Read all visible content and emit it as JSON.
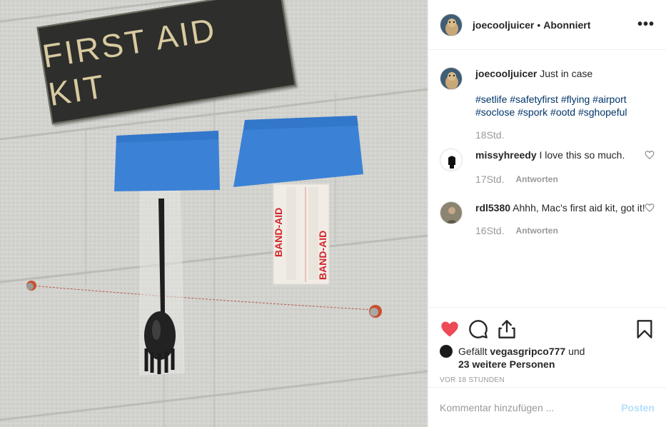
{
  "post": {
    "photo": {
      "sign_text": "FIRST AID KIT",
      "bandaid_brand": "BAND-AID"
    },
    "header": {
      "username": "joecooljuicer",
      "separator": "•",
      "follow_label": "Abonniert",
      "more_icon": "more-horizontal-icon"
    },
    "caption": {
      "username": "joecooljuicer",
      "text": "Just in case",
      "hashtags": "#setlife #safetyfirst #flying #airport #soclose #spork #ootd #sghopeful",
      "time": "18Std."
    },
    "comments": [
      {
        "username": "missyhreedy",
        "text": "I love this so much.",
        "time": "17Std.",
        "reply_label": "Antworten"
      },
      {
        "username": "rdl5380",
        "text": "Ahhh, Mac's first aid kit, got it!",
        "time": "16Std.",
        "reply_label": "Antworten"
      }
    ],
    "actions": {
      "like_icon": "heart-filled-icon",
      "comment_icon": "comment-icon",
      "share_icon": "share-icon",
      "save_icon": "bookmark-icon",
      "liked_color": "#ed4956"
    },
    "likes": {
      "prefix": "Gefällt",
      "user": "vegasgripco777",
      "joiner": "und",
      "others": "23 weitere Personen"
    },
    "timestamp": "VOR 18 STUNDEN",
    "add_comment": {
      "placeholder": "Kommentar hinzufügen ...",
      "post_label": "Posten"
    }
  }
}
